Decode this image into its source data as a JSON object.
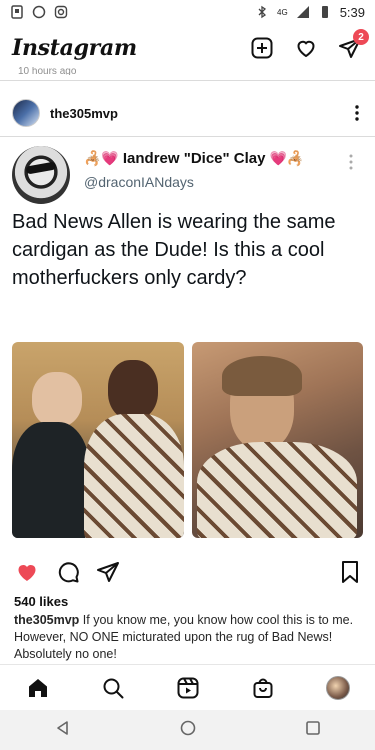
{
  "status_bar": {
    "time": "5:39",
    "network": "4G"
  },
  "app": {
    "logo": "Instagram",
    "notification_count": "2"
  },
  "previous_post": {
    "time_ago": "10 hours ago"
  },
  "post": {
    "username": "the305mvp",
    "tweet": {
      "display_name": "Iandrew \"Dice\" Clay",
      "handle": "@draconIANdays",
      "text": "Bad News Allen is wearing the same cardigan as the Dude! Is this a cool motherfuckers only cardy?",
      "emoji_left": "🦂💗",
      "emoji_right": "💗🦂"
    },
    "likes": "540 likes",
    "caption_user": "the305mvp",
    "caption_text": "If you know me, you know how cool this is to me. However, NO ONE micturated upon the rug of Bad News! Absolutely no one!"
  },
  "colors": {
    "like_red": "#ed4956",
    "divider": "#dbdbdb"
  },
  "icons": {
    "header": [
      "new-post-icon",
      "heart-icon",
      "direct-message-icon"
    ],
    "actions": [
      "heart-filled-icon",
      "comment-icon",
      "share-icon",
      "bookmark-icon"
    ],
    "tabs": [
      "home-icon",
      "search-icon",
      "reels-icon",
      "shop-icon",
      "profile-avatar"
    ],
    "system": [
      "back-icon",
      "home-circle-icon",
      "recents-icon"
    ]
  }
}
